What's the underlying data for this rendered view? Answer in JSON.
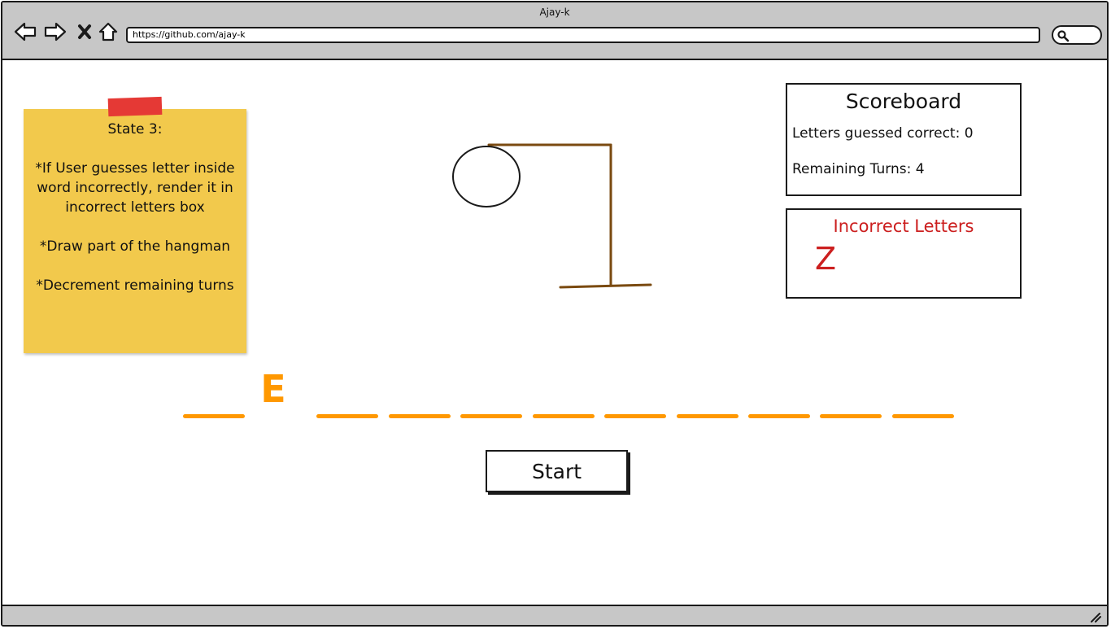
{
  "window": {
    "title": "Ajay-k",
    "url": "https://github.com/ajay-k"
  },
  "toolbar": {
    "back_icon": "back-arrow-icon",
    "forward_icon": "forward-arrow-icon",
    "stop_icon": "close-icon",
    "home_icon": "home-icon",
    "search_icon": "search-icon"
  },
  "note": {
    "paragraphs": [
      "State 3:",
      "*If User guesses letter inside word incorrectly, render it in incorrect letters box",
      "*Draw part of the hangman",
      "*Decrement remaining turns"
    ]
  },
  "scoreboard": {
    "title": "Scoreboard",
    "correct_label": "Letters guessed correct: 0",
    "remaining_label": "Remaining Turns: 4"
  },
  "incorrect": {
    "title": "Incorrect Letters",
    "letters": [
      "Z"
    ]
  },
  "word": {
    "slots": [
      "",
      "E",
      "",
      "",
      "",
      "",
      "",
      "",
      "",
      "",
      ""
    ]
  },
  "start_button": {
    "label": "Start"
  },
  "colors": {
    "accent": "#ff9800",
    "incorrect": "#cc1f1f",
    "note": "#f2c94c",
    "tape": "#e53935",
    "gallows": "#7a4a10"
  }
}
